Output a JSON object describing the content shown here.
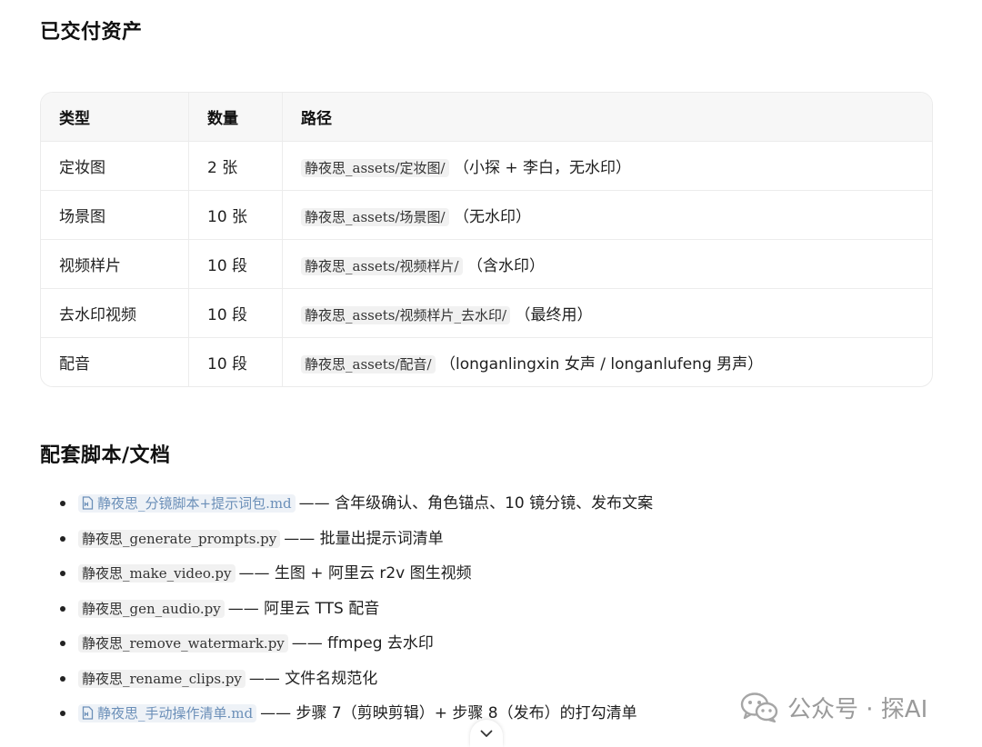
{
  "assets_heading": "已交付资产",
  "assets_table": {
    "headers": [
      "类型",
      "数量",
      "路径"
    ],
    "rows": [
      {
        "type": "定妆图",
        "count": "2 张",
        "path": "静夜思_assets/定妆图/",
        "note": "（小探 + 李白，无水印）"
      },
      {
        "type": "场景图",
        "count": "10 张",
        "path": "静夜思_assets/场景图/",
        "note": "（无水印）"
      },
      {
        "type": "视频样片",
        "count": "10 段",
        "path": "静夜思_assets/视频样片/",
        "note": "（含水印）"
      },
      {
        "type": "去水印视频",
        "count": "10 段",
        "path": "静夜思_assets/视频样片_去水印/",
        "note": "（最终用）"
      },
      {
        "type": "配音",
        "count": "10 段",
        "path": "静夜思_assets/配音/",
        "note": "（longanlingxin 女声 / longanlufeng 男声）"
      }
    ]
  },
  "scripts_heading": "配套脚本/文档",
  "scripts": [
    {
      "file": "静夜思_分镜脚本+提示词包.md",
      "desc": "—— 含年级确认、角色锚点、10 镜分镜、发布文案",
      "icon": "file-icon"
    },
    {
      "file": "静夜思_generate_prompts.py",
      "desc": "—— 批量出提示词清单"
    },
    {
      "file": "静夜思_make_video.py",
      "desc": "—— 生图 + 阿里云 r2v 图生视频"
    },
    {
      "file": "静夜思_gen_audio.py",
      "desc": "—— 阿里云 TTS 配音"
    },
    {
      "file": "静夜思_remove_watermark.py",
      "desc": "—— ffmpeg 去水印"
    },
    {
      "file": "静夜思_rename_clips.py",
      "desc": "—— 文件名规范化"
    },
    {
      "file": "静夜思_手动操作清单.md",
      "desc": "—— 步骤 7（剪映剪辑）+ 步骤 8（发布）的打勾清单",
      "icon": "file-icon"
    }
  ],
  "watermark": {
    "text": "公众号 · 探AI",
    "icon": "wechat-icon"
  },
  "scroll_button": {
    "icon": "chevron-down-icon"
  }
}
